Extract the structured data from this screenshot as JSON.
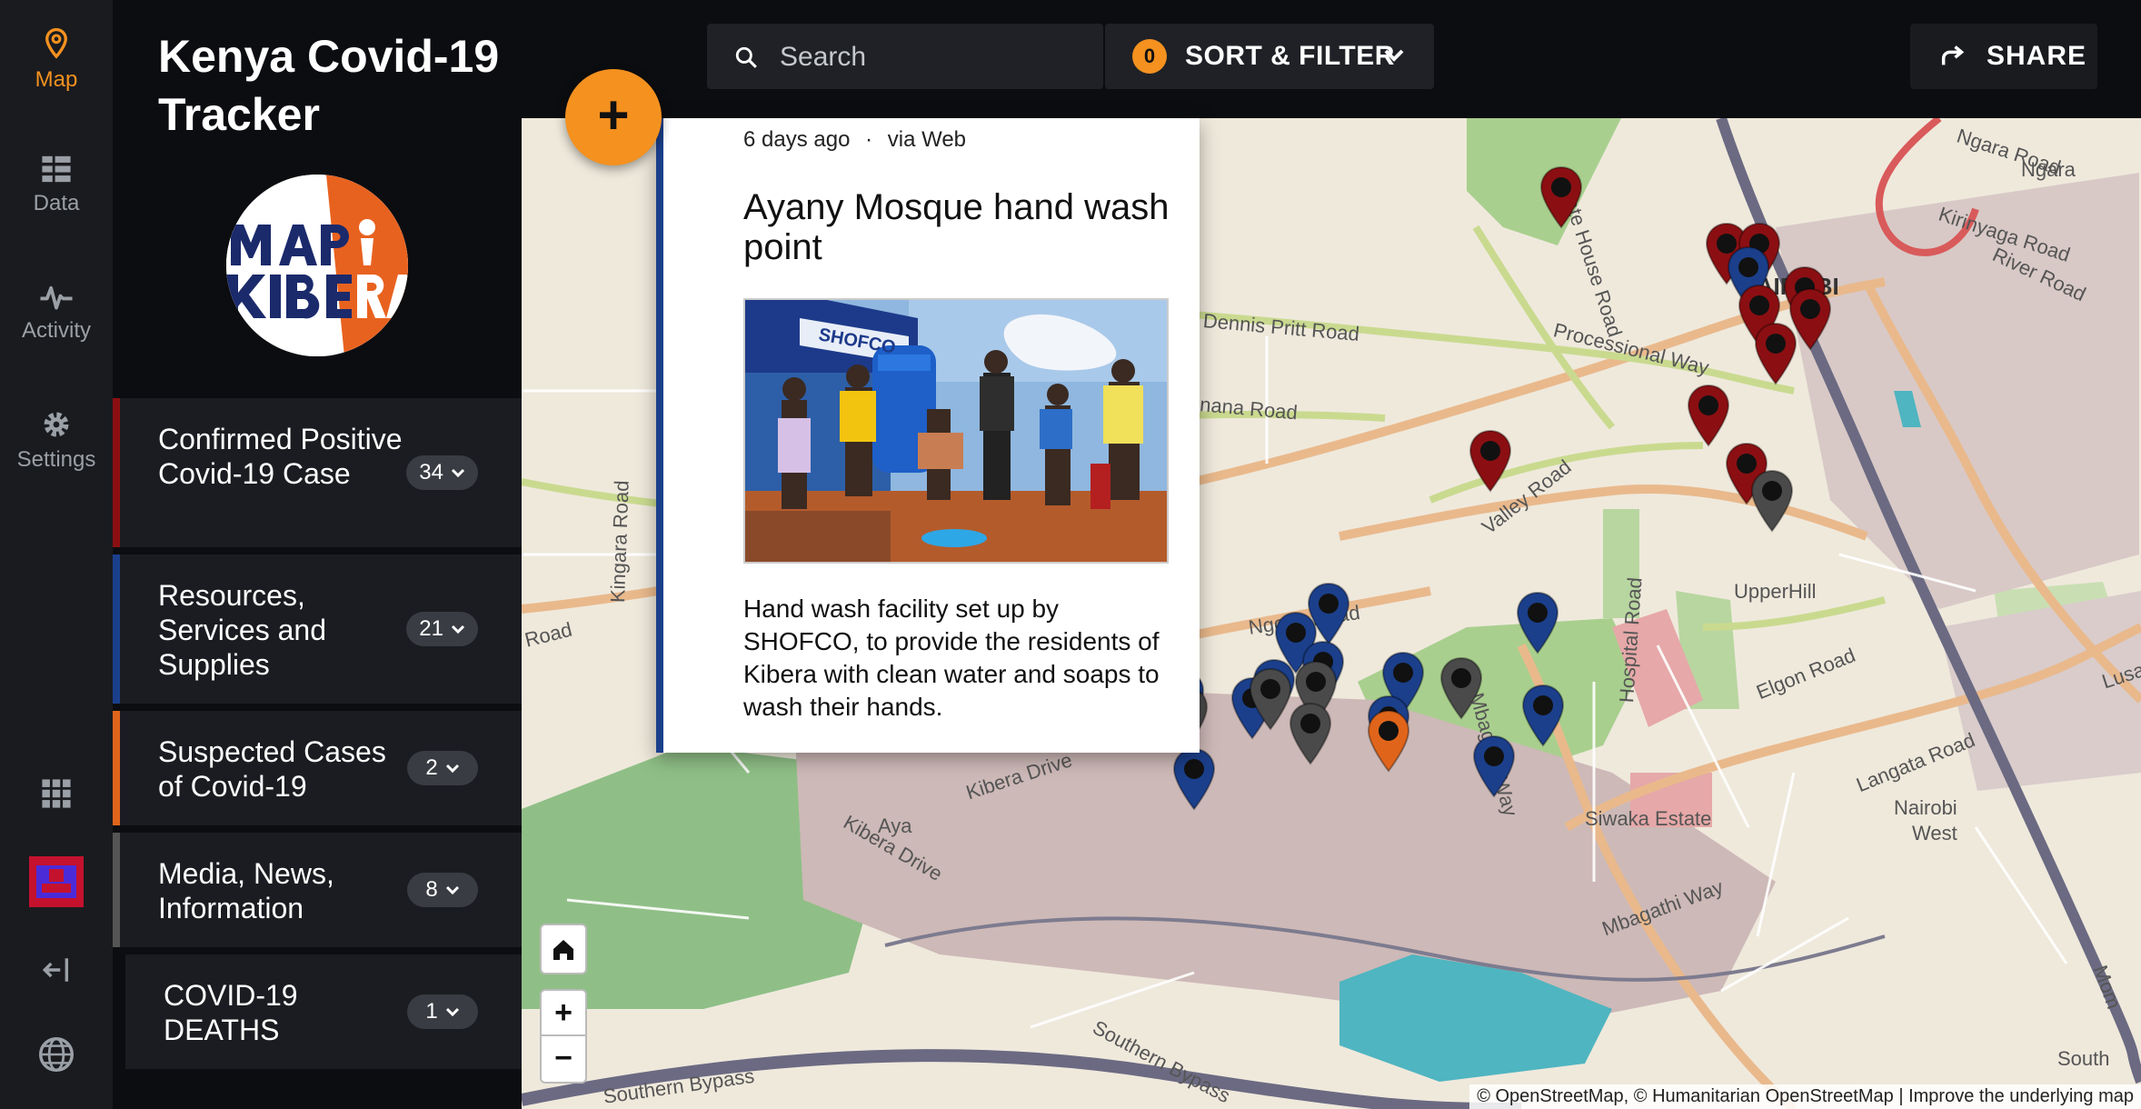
{
  "nav": {
    "map": "Map",
    "data": "Data",
    "activity": "Activity",
    "settings": "Settings"
  },
  "deployment": {
    "title": "Kenya Covid-19 Tracker"
  },
  "categories": [
    {
      "name": "Confirmed Positive Covid-19 Case",
      "count": "34",
      "color": "#8b0f12"
    },
    {
      "name": "Resources, Services and Supplies",
      "count": "21",
      "color": "#1b3f8b"
    },
    {
      "name": "Suspected Cases of Covid-19",
      "count": "2",
      "color": "#e0651b"
    },
    {
      "name": "Media, News, Information",
      "count": "8",
      "color": "#555555"
    },
    {
      "name": "COVID-19 DEATHS",
      "count": "1",
      "color": "#1b1c21"
    }
  ],
  "topbar": {
    "search_placeholder": "Search",
    "filter_count": "0",
    "sort_filter_label": "SORT & FILTER",
    "share_label": "SHARE"
  },
  "post": {
    "time": "6 days ago",
    "separator": "·",
    "source": "via Web",
    "title": "Ayany Mosque hand wash point",
    "description": "Hand wash facility set up by SHOFCO, to provide the residents of Kibera with clean water and soaps to wash their hands."
  },
  "map": {
    "attribution": "© OpenStreetMap, © Humanitarian OpenStreetMap | Improve the underlying map",
    "zoom_in": "+",
    "zoom_out": "−",
    "labels": {
      "ngara_road": "Ngara Road",
      "ngara": "Ngara",
      "kirinyaga_road": "Kirinyaga Road",
      "river_road": "River Road",
      "nairobi": "NAIROBI",
      "state_house_road": "State House Road",
      "processional_way": "Processional Way",
      "dennis_pritt_road": "Dennis Pritt Road",
      "lenana_road": "Lenana Road",
      "valley_road": "Valley Road",
      "kingara_road": "Kingara Road",
      "ngong_road": "Ngong Road",
      "hospital_road": "Hospital Road",
      "upper_hill": "UpperHill",
      "elgon_road": "Elgon Road",
      "mbagathi_way_v": "Mbagathi Way",
      "langata_road": "Langata Road",
      "siwaka_estate": "Siwaka Estate",
      "nairobi_west_1": "Nairobi",
      "nairobi_west_2": "West",
      "kibera_drive": "Kibera Drive",
      "kibera_drive_2": "Kibera Drive",
      "mbagathi_way": "Mbagathi Way",
      "southern_bypass": "Southern Bypass",
      "southern_bypass_2": "Southern Bypass",
      "south": "South",
      "road": "Road",
      "lusaka": "Lusa",
      "ayany": "Aya",
      "mom": "Mom"
    }
  },
  "colors": {
    "accent": "#f4911f",
    "confirmed": "#8b0f12",
    "resources": "#1b3f8b",
    "suspected": "#e0651b",
    "media": "#555555"
  }
}
